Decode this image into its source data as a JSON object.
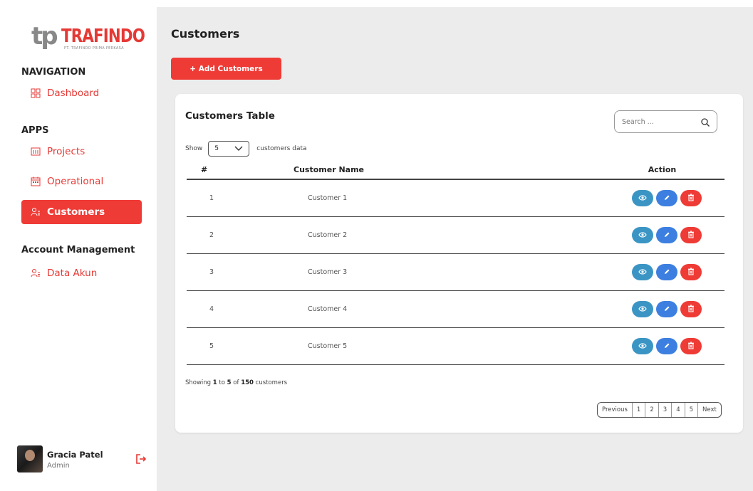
{
  "brand": {
    "logo_mark": "tp",
    "logo_name": "TRAFINDO",
    "logo_sub": "PT. TRAFINDO PRIMA PERKASA",
    "accent": "#ef3b36"
  },
  "sidebar": {
    "nav_title": "NAVIGATION",
    "apps_title": "APPS",
    "account_title": "Account Management",
    "items": [
      {
        "label": "Dashboard",
        "icon": "dashboard-icon"
      },
      {
        "label": "Projects",
        "icon": "projects-icon"
      },
      {
        "label": "Operational",
        "icon": "calendar-icon"
      },
      {
        "label": "Customers",
        "icon": "customers-icon",
        "active": true
      },
      {
        "label": "Data Akun",
        "icon": "users-icon"
      }
    ]
  },
  "user": {
    "name": "Gracia Patel",
    "role": "Admin"
  },
  "main": {
    "title": "Customers",
    "add_button": "+ Add Customers"
  },
  "table_card": {
    "title": "Customers Table",
    "search_placeholder": "Search ...",
    "show_label": "Show",
    "show_value": "5",
    "show_suffix": "customers data",
    "headers": [
      "#",
      "Customer Name",
      "Action"
    ],
    "rows": [
      {
        "num": "1",
        "name": "Customer 1"
      },
      {
        "num": "2",
        "name": "Customer 2"
      },
      {
        "num": "3",
        "name": "Customer 3"
      },
      {
        "num": "4",
        "name": "Customer 4"
      },
      {
        "num": "5",
        "name": "Customer 5"
      }
    ],
    "showing_prefix": "Showing",
    "showing_from": "1",
    "showing_to_word": "to",
    "showing_to": "5",
    "showing_of_word": "of",
    "showing_total": "150",
    "showing_suffix": "customers",
    "pagination": [
      "Previous",
      "1",
      "2",
      "3",
      "4",
      "5",
      "Next"
    ]
  }
}
